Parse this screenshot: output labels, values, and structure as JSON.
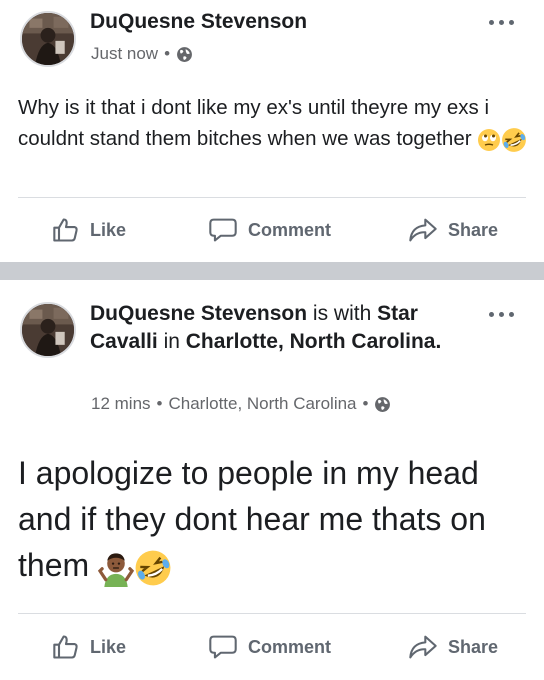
{
  "post1": {
    "author": "DuQuesne Stevenson",
    "time": "Just now",
    "meta_separator": "•",
    "privacy_icon": "globe-icon",
    "text": "Why is it that i dont like my ex's until theyre my exs i couldnt stand them bitches when we was together",
    "emojis": [
      "face-with-rolling-eyes",
      "rolling-on-the-floor-laughing"
    ],
    "actions": {
      "like": "Like",
      "comment": "Comment",
      "share": "Share"
    }
  },
  "post2": {
    "author": "DuQuesne Stevenson",
    "with_word": "is with",
    "tagged": "Star Cavalli",
    "in_word": "in",
    "place": "Charlotte, North Carolina.",
    "time": "12 mins",
    "meta_separator": "•",
    "location": "Charlotte, North Carolina",
    "privacy_icon": "globe-icon",
    "text": "I apologize to people in my head and if they dont hear me thats on them",
    "emojis": [
      "person-shrugging",
      "rolling-on-the-floor-laughing"
    ],
    "actions": {
      "like": "Like",
      "comment": "Comment",
      "share": "Share"
    }
  },
  "colors": {
    "text_primary": "#1c1e21",
    "text_secondary": "#65676b",
    "action_gray": "#606770",
    "divider_band": "#c9ccd1",
    "separator": "#dadde1"
  }
}
